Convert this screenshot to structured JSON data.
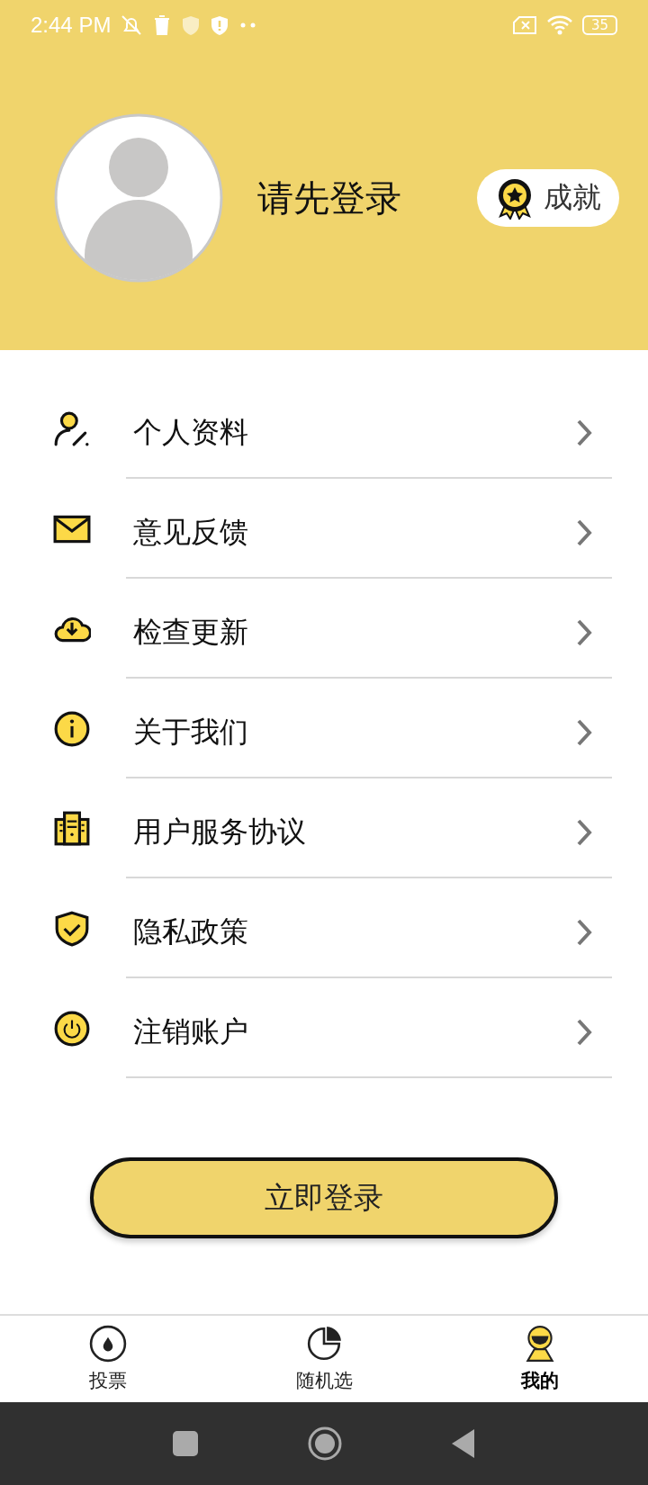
{
  "status_bar": {
    "time": "2:44 PM",
    "battery": "35"
  },
  "profile": {
    "name": "请先登录",
    "achievement": "成就"
  },
  "menu": [
    {
      "kind": "profile",
      "label": "个人资料"
    },
    {
      "kind": "mail",
      "label": "意见反馈"
    },
    {
      "kind": "update",
      "label": "检查更新"
    },
    {
      "kind": "info",
      "label": "关于我们"
    },
    {
      "kind": "agreement",
      "label": "用户服务协议"
    },
    {
      "kind": "privacy",
      "label": "隐私政策"
    },
    {
      "kind": "logout",
      "label": "注销账户"
    }
  ],
  "login_button": "立即登录",
  "tabs": [
    {
      "kind": "vote",
      "label": "投票",
      "selected": false
    },
    {
      "kind": "random",
      "label": "随机选",
      "selected": false
    },
    {
      "kind": "me",
      "label": "我的",
      "selected": true
    }
  ]
}
